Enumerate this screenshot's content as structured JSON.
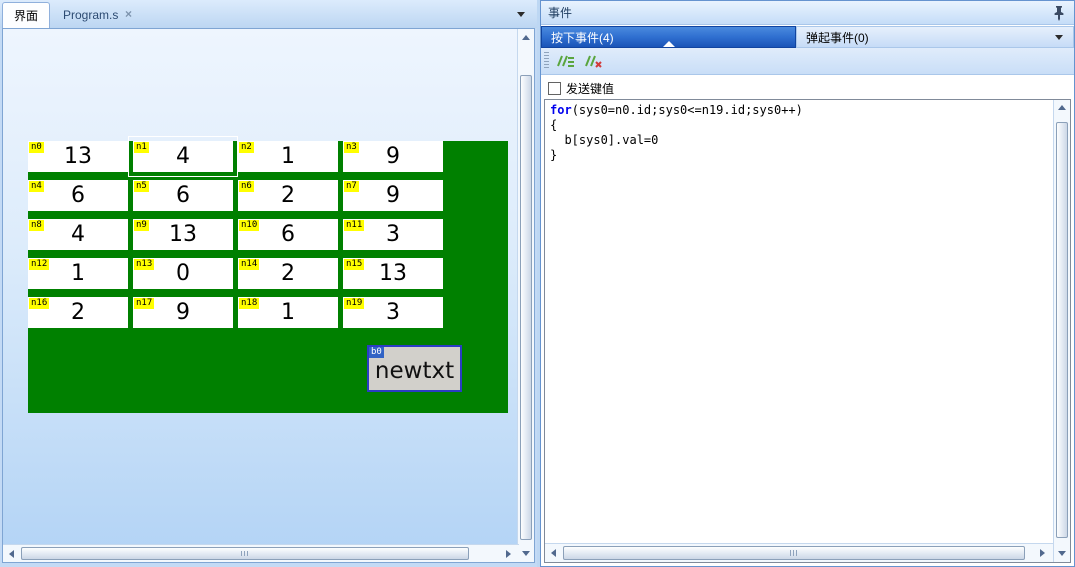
{
  "left_panel": {
    "tabs": [
      {
        "label": "界面",
        "active": true
      },
      {
        "label": "Program.s",
        "active": false
      }
    ],
    "close_icon": "×",
    "designer": {
      "textboxes": [
        {
          "name": "n0",
          "value": "13"
        },
        {
          "name": "n1",
          "value": "4",
          "outlined": true
        },
        {
          "name": "n2",
          "value": "1"
        },
        {
          "name": "n3",
          "value": "9"
        },
        {
          "name": "n4",
          "value": "6"
        },
        {
          "name": "n5",
          "value": "6"
        },
        {
          "name": "n6",
          "value": "2"
        },
        {
          "name": "n7",
          "value": "9"
        },
        {
          "name": "n8",
          "value": "4"
        },
        {
          "name": "n9",
          "value": "13"
        },
        {
          "name": "n10",
          "value": "6"
        },
        {
          "name": "n11",
          "value": "3"
        },
        {
          "name": "n12",
          "value": "1"
        },
        {
          "name": "n13",
          "value": "0"
        },
        {
          "name": "n14",
          "value": "2"
        },
        {
          "name": "n15",
          "value": "13"
        },
        {
          "name": "n16",
          "value": "2"
        },
        {
          "name": "n17",
          "value": "9"
        },
        {
          "name": "n18",
          "value": "1"
        },
        {
          "name": "n19",
          "value": "3"
        }
      ],
      "button": {
        "name": "b0",
        "label": "newtxt",
        "selected": true
      }
    }
  },
  "right_panel": {
    "title": "事件",
    "tabs": [
      {
        "label": "按下事件(4)",
        "active": true
      },
      {
        "label": "弹起事件(0)",
        "active": false
      }
    ],
    "checkbox": {
      "label": "发送键值",
      "checked": false
    },
    "code_lines": [
      {
        "keyword": "for",
        "text": "(sys0=n0.id;sys0<=n19.id;sys0++)"
      },
      {
        "keyword": "",
        "text": "{"
      },
      {
        "keyword": "",
        "text": "  b[sys0].val=0"
      },
      {
        "keyword": "",
        "text": "}"
      }
    ]
  },
  "colors": {
    "form_canvas_green": "#008000",
    "label_yellow": "#ffff00",
    "selection_blue": "#3163c5",
    "keyword_blue": "#0000ee",
    "button_border_blue": "#2b3cc4"
  }
}
